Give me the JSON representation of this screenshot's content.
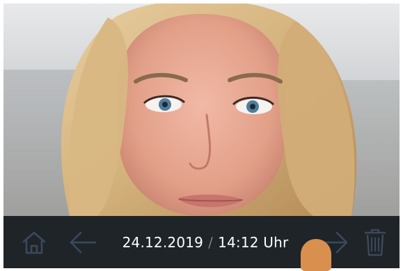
{
  "screen": {
    "camera_view": {
      "subject": "visitor-face-image"
    },
    "bottom_bar": {
      "home_icon": "home-icon",
      "back_icon": "arrow-left-icon",
      "date": "24.12.2019",
      "separator": "/",
      "time": "14:12 Uhr",
      "next_icon": "arrow-right-icon",
      "delete_icon": "trash-icon"
    }
  },
  "colors": {
    "bar_background": "#1f2428",
    "icon_color": "#3a4a5c",
    "text_color": "#ffffff",
    "separator_color": "#7b7f84",
    "finger_color": "#d98f4e"
  }
}
